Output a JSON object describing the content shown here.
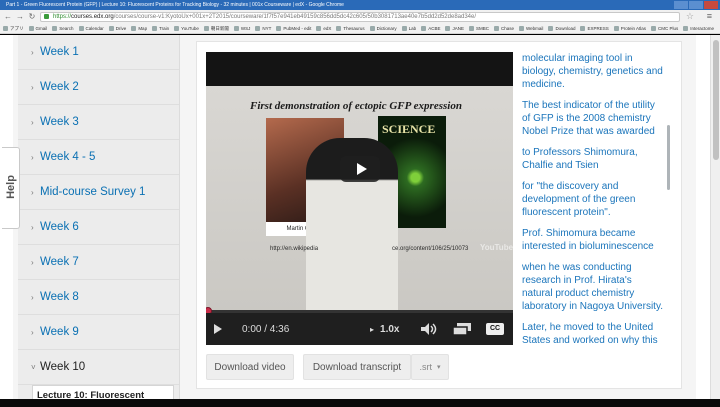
{
  "window": {
    "title": "Part 1 - Green Fluorescent Protein (GFP) | Lecture 10: Fluorescent Proteins for Tracking Biology - 32 minutes | 001x Courseware | edX - Google Chrome"
  },
  "browser": {
    "url_scheme": "https://",
    "url_host": "courses.edx.org",
    "url_path": "/courses/course-v1:KyotoUx+001x+2T2015/courseware/1f7f57e941eb49159c856dd5dc42c605/50b3081713ae40e7b5dd2d52de8ad34e/",
    "bookmarks": [
      "アプリ",
      "Gmail",
      "Search",
      "Calendar",
      "Drive",
      "Map",
      "Train",
      "YouTube",
      "朝日新聞",
      "WSJ",
      "NYT",
      "PubMed - edit",
      "edX",
      "Thesaurus",
      "Dictionary",
      "Lab",
      "ACBE",
      "JANE",
      "SMBC",
      "Chase",
      "Webmail",
      "Download",
      "EXPRESS",
      "Protein Atlas",
      "CMC Plus",
      "Interactome"
    ]
  },
  "help": {
    "label": "Help"
  },
  "sidebar": {
    "weeks": [
      {
        "label": "Week 1"
      },
      {
        "label": "Week 2"
      },
      {
        "label": "Week 3"
      },
      {
        "label": "Week 4 - 5"
      },
      {
        "label": "Mid-course Survey 1"
      },
      {
        "label": "Week 6"
      },
      {
        "label": "Week 7"
      },
      {
        "label": "Week 8"
      },
      {
        "label": "Week 9"
      },
      {
        "label": "Week 10"
      }
    ],
    "active_lecture": "Lecture 10: Fluorescent"
  },
  "video": {
    "slide_title": "First demonstration of ectopic GFP expression",
    "photo_caption": "Martin Chalfie",
    "journal": "SCIENCE",
    "slide_url_left": "http://en.wikipedia",
    "slide_url_right": "ce.org/content/106/25/10073",
    "watermark": "YouTube",
    "time": "0:00 / 4:36",
    "speed": "1.0x",
    "cc_label": "CC"
  },
  "actions": {
    "download_video": "Download video",
    "download_transcript": "Download transcript",
    "transcript_format": ".srt"
  },
  "transcript": {
    "lines": [
      "molecular imaging tool in biology, chemistry, genetics and medicine.",
      "The best indicator of the utility of GFP is the 2008 chemistry Nobel Prize that was awarded",
      "to Professors Shimomura, Chalfie and Tsien",
      "for \"the discovery and development of the green fluorescent protein\".",
      "Prof. Shimomura became interested in bioluminescence",
      "when he was conducting research in Prof. Hirata's natural product chemistry laboratory in Nagoya University.",
      "Later, he moved to the United States and worked on why this fluorescent jellyfish is"
    ]
  },
  "colors": {
    "link_blue": "#0a70b3",
    "transcript_blue": "#1b75bb",
    "progress_red": "#c72c48"
  }
}
